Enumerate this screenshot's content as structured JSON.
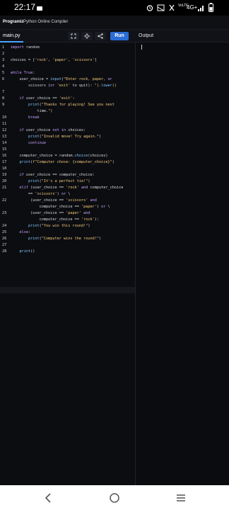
{
  "status": {
    "time": "22:17",
    "network": "4G+"
  },
  "app": {
    "brand": "Programiz",
    "subtitle": "Python Online Compiler"
  },
  "toolbar": {
    "file_tab": "main.py",
    "run_label": "Run",
    "output_label": "Output"
  },
  "editor": {
    "lines": [
      {
        "n": "1",
        "text": "import random"
      },
      {
        "n": "2",
        "text": ""
      },
      {
        "n": "3",
        "text": "choices = ['rock', 'paper', 'scissors']"
      },
      {
        "n": "4",
        "text": ""
      },
      {
        "n": "5",
        "text": "while True:"
      },
      {
        "n": "6",
        "text": "    user_choice = input(\"Enter rock, paper, or"
      },
      {
        "n": "",
        "text": "        scissors (or 'exit' to quit): \").lower()"
      },
      {
        "n": "7",
        "text": ""
      },
      {
        "n": "8",
        "text": "    if user_choice == 'exit':"
      },
      {
        "n": "9",
        "text": "        print(\"Thanks for playing! See you next"
      },
      {
        "n": "",
        "text": "            time.\")"
      },
      {
        "n": "10",
        "text": "        break"
      },
      {
        "n": "11",
        "text": ""
      },
      {
        "n": "12",
        "text": "    if user_choice not in choices:"
      },
      {
        "n": "13",
        "text": "        print(\"Invalid move! Try again.\")"
      },
      {
        "n": "14",
        "text": "        continue"
      },
      {
        "n": "15",
        "text": ""
      },
      {
        "n": "16",
        "text": "    computer_choice = random.choice(choices)"
      },
      {
        "n": "17",
        "text": "    print(f\"Computer chose: {computer_choice}\")"
      },
      {
        "n": "18",
        "text": ""
      },
      {
        "n": "19",
        "text": "    if user_choice == computer_choice:"
      },
      {
        "n": "20",
        "text": "        print(\"It's a perfect tie!\")"
      },
      {
        "n": "21",
        "text": "    elif (user_choice == 'rock' and computer_choice"
      },
      {
        "n": "",
        "text": "        == 'scissors') or \\"
      },
      {
        "n": "22",
        "text": "         (user_choice == 'scissors' and"
      },
      {
        "n": "",
        "text": "             computer_choice == 'paper') or \\"
      },
      {
        "n": "23",
        "text": "         (user_choice == 'paper' and"
      },
      {
        "n": "",
        "text": "             computer_choice == 'rock'):"
      },
      {
        "n": "24",
        "text": "        print(\"You win this round!\")"
      },
      {
        "n": "25",
        "text": "    else:"
      },
      {
        "n": "26",
        "text": "        print(\"Computer wins the round!\")"
      },
      {
        "n": "27",
        "text": ""
      },
      {
        "n": "28",
        "text": "    print()"
      }
    ]
  },
  "colors": {
    "accent": "#2b6cd6",
    "tab_underline": "#4aa3ff",
    "keyword": "#c6a2ff",
    "string": "#f2c97d"
  },
  "icons": [
    "alarm-icon",
    "cast-icon",
    "mute-icon",
    "volte-icon",
    "signal-icon",
    "battery-icon",
    "fullscreen-icon",
    "settings-icon",
    "share-icon",
    "back-icon",
    "home-icon",
    "recents-icon"
  ]
}
